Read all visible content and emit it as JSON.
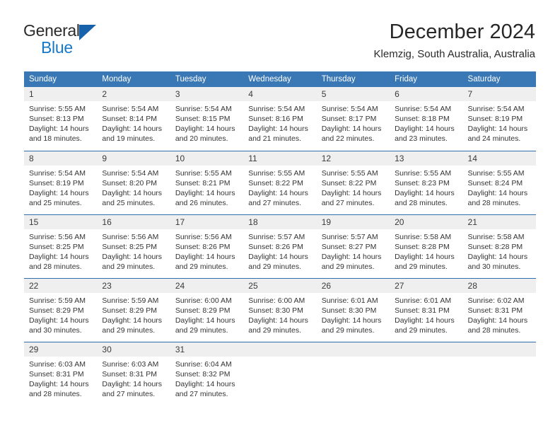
{
  "brand": {
    "name_part1": "General",
    "name_part2": "Blue",
    "triangle_icon": "triangle-icon",
    "accent_color": "#1878c8",
    "triangle_color": "#1862ab"
  },
  "header": {
    "title": "December 2024",
    "location": "Klemzig, South Australia, Australia"
  },
  "calendar": {
    "header_bg_color": "#3a78b5",
    "daynum_bg_color": "#efefef",
    "separator_color": "#2f6fac",
    "weekday_headers": [
      "Sunday",
      "Monday",
      "Tuesday",
      "Wednesday",
      "Thursday",
      "Friday",
      "Saturday"
    ],
    "weeks": [
      [
        {
          "day": "1",
          "sunrise": "Sunrise: 5:55 AM",
          "sunset": "Sunset: 8:13 PM",
          "daylight_line1": "Daylight: 14 hours",
          "daylight_line2": "and 18 minutes."
        },
        {
          "day": "2",
          "sunrise": "Sunrise: 5:54 AM",
          "sunset": "Sunset: 8:14 PM",
          "daylight_line1": "Daylight: 14 hours",
          "daylight_line2": "and 19 minutes."
        },
        {
          "day": "3",
          "sunrise": "Sunrise: 5:54 AM",
          "sunset": "Sunset: 8:15 PM",
          "daylight_line1": "Daylight: 14 hours",
          "daylight_line2": "and 20 minutes."
        },
        {
          "day": "4",
          "sunrise": "Sunrise: 5:54 AM",
          "sunset": "Sunset: 8:16 PM",
          "daylight_line1": "Daylight: 14 hours",
          "daylight_line2": "and 21 minutes."
        },
        {
          "day": "5",
          "sunrise": "Sunrise: 5:54 AM",
          "sunset": "Sunset: 8:17 PM",
          "daylight_line1": "Daylight: 14 hours",
          "daylight_line2": "and 22 minutes."
        },
        {
          "day": "6",
          "sunrise": "Sunrise: 5:54 AM",
          "sunset": "Sunset: 8:18 PM",
          "daylight_line1": "Daylight: 14 hours",
          "daylight_line2": "and 23 minutes."
        },
        {
          "day": "7",
          "sunrise": "Sunrise: 5:54 AM",
          "sunset": "Sunset: 8:19 PM",
          "daylight_line1": "Daylight: 14 hours",
          "daylight_line2": "and 24 minutes."
        }
      ],
      [
        {
          "day": "8",
          "sunrise": "Sunrise: 5:54 AM",
          "sunset": "Sunset: 8:19 PM",
          "daylight_line1": "Daylight: 14 hours",
          "daylight_line2": "and 25 minutes."
        },
        {
          "day": "9",
          "sunrise": "Sunrise: 5:54 AM",
          "sunset": "Sunset: 8:20 PM",
          "daylight_line1": "Daylight: 14 hours",
          "daylight_line2": "and 25 minutes."
        },
        {
          "day": "10",
          "sunrise": "Sunrise: 5:55 AM",
          "sunset": "Sunset: 8:21 PM",
          "daylight_line1": "Daylight: 14 hours",
          "daylight_line2": "and 26 minutes."
        },
        {
          "day": "11",
          "sunrise": "Sunrise: 5:55 AM",
          "sunset": "Sunset: 8:22 PM",
          "daylight_line1": "Daylight: 14 hours",
          "daylight_line2": "and 27 minutes."
        },
        {
          "day": "12",
          "sunrise": "Sunrise: 5:55 AM",
          "sunset": "Sunset: 8:22 PM",
          "daylight_line1": "Daylight: 14 hours",
          "daylight_line2": "and 27 minutes."
        },
        {
          "day": "13",
          "sunrise": "Sunrise: 5:55 AM",
          "sunset": "Sunset: 8:23 PM",
          "daylight_line1": "Daylight: 14 hours",
          "daylight_line2": "and 28 minutes."
        },
        {
          "day": "14",
          "sunrise": "Sunrise: 5:55 AM",
          "sunset": "Sunset: 8:24 PM",
          "daylight_line1": "Daylight: 14 hours",
          "daylight_line2": "and 28 minutes."
        }
      ],
      [
        {
          "day": "15",
          "sunrise": "Sunrise: 5:56 AM",
          "sunset": "Sunset: 8:25 PM",
          "daylight_line1": "Daylight: 14 hours",
          "daylight_line2": "and 28 minutes."
        },
        {
          "day": "16",
          "sunrise": "Sunrise: 5:56 AM",
          "sunset": "Sunset: 8:25 PM",
          "daylight_line1": "Daylight: 14 hours",
          "daylight_line2": "and 29 minutes."
        },
        {
          "day": "17",
          "sunrise": "Sunrise: 5:56 AM",
          "sunset": "Sunset: 8:26 PM",
          "daylight_line1": "Daylight: 14 hours",
          "daylight_line2": "and 29 minutes."
        },
        {
          "day": "18",
          "sunrise": "Sunrise: 5:57 AM",
          "sunset": "Sunset: 8:26 PM",
          "daylight_line1": "Daylight: 14 hours",
          "daylight_line2": "and 29 minutes."
        },
        {
          "day": "19",
          "sunrise": "Sunrise: 5:57 AM",
          "sunset": "Sunset: 8:27 PM",
          "daylight_line1": "Daylight: 14 hours",
          "daylight_line2": "and 29 minutes."
        },
        {
          "day": "20",
          "sunrise": "Sunrise: 5:58 AM",
          "sunset": "Sunset: 8:28 PM",
          "daylight_line1": "Daylight: 14 hours",
          "daylight_line2": "and 29 minutes."
        },
        {
          "day": "21",
          "sunrise": "Sunrise: 5:58 AM",
          "sunset": "Sunset: 8:28 PM",
          "daylight_line1": "Daylight: 14 hours",
          "daylight_line2": "and 30 minutes."
        }
      ],
      [
        {
          "day": "22",
          "sunrise": "Sunrise: 5:59 AM",
          "sunset": "Sunset: 8:29 PM",
          "daylight_line1": "Daylight: 14 hours",
          "daylight_line2": "and 30 minutes."
        },
        {
          "day": "23",
          "sunrise": "Sunrise: 5:59 AM",
          "sunset": "Sunset: 8:29 PM",
          "daylight_line1": "Daylight: 14 hours",
          "daylight_line2": "and 29 minutes."
        },
        {
          "day": "24",
          "sunrise": "Sunrise: 6:00 AM",
          "sunset": "Sunset: 8:29 PM",
          "daylight_line1": "Daylight: 14 hours",
          "daylight_line2": "and 29 minutes."
        },
        {
          "day": "25",
          "sunrise": "Sunrise: 6:00 AM",
          "sunset": "Sunset: 8:30 PM",
          "daylight_line1": "Daylight: 14 hours",
          "daylight_line2": "and 29 minutes."
        },
        {
          "day": "26",
          "sunrise": "Sunrise: 6:01 AM",
          "sunset": "Sunset: 8:30 PM",
          "daylight_line1": "Daylight: 14 hours",
          "daylight_line2": "and 29 minutes."
        },
        {
          "day": "27",
          "sunrise": "Sunrise: 6:01 AM",
          "sunset": "Sunset: 8:31 PM",
          "daylight_line1": "Daylight: 14 hours",
          "daylight_line2": "and 29 minutes."
        },
        {
          "day": "28",
          "sunrise": "Sunrise: 6:02 AM",
          "sunset": "Sunset: 8:31 PM",
          "daylight_line1": "Daylight: 14 hours",
          "daylight_line2": "and 28 minutes."
        }
      ],
      [
        {
          "day": "29",
          "sunrise": "Sunrise: 6:03 AM",
          "sunset": "Sunset: 8:31 PM",
          "daylight_line1": "Daylight: 14 hours",
          "daylight_line2": "and 28 minutes."
        },
        {
          "day": "30",
          "sunrise": "Sunrise: 6:03 AM",
          "sunset": "Sunset: 8:31 PM",
          "daylight_line1": "Daylight: 14 hours",
          "daylight_line2": "and 27 minutes."
        },
        {
          "day": "31",
          "sunrise": "Sunrise: 6:04 AM",
          "sunset": "Sunset: 8:32 PM",
          "daylight_line1": "Daylight: 14 hours",
          "daylight_line2": "and 27 minutes."
        },
        {
          "day": "",
          "sunrise": "",
          "sunset": "",
          "daylight_line1": "",
          "daylight_line2": ""
        },
        {
          "day": "",
          "sunrise": "",
          "sunset": "",
          "daylight_line1": "",
          "daylight_line2": ""
        },
        {
          "day": "",
          "sunrise": "",
          "sunset": "",
          "daylight_line1": "",
          "daylight_line2": ""
        },
        {
          "day": "",
          "sunrise": "",
          "sunset": "",
          "daylight_line1": "",
          "daylight_line2": ""
        }
      ]
    ]
  }
}
